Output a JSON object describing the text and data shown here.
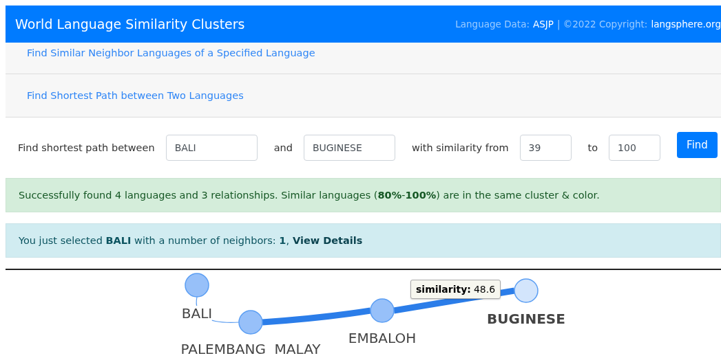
{
  "header": {
    "title": "World Language Similarity Clusters",
    "credits": [
      {
        "kind": "label",
        "text": "Language Data:"
      },
      {
        "kind": "link",
        "text": "ASJP"
      },
      {
        "kind": "label",
        "text": "| ©2022 Copyright:"
      },
      {
        "kind": "link",
        "text": "langsphere.org"
      }
    ]
  },
  "sections": [
    {
      "label": "Find Similar Neighbor Languages of a Specified Language"
    },
    {
      "label": "Find Shortest Path between Two Languages"
    }
  ],
  "form": {
    "items": [
      {
        "kind": "text",
        "text": "Find shortest path between"
      },
      {
        "kind": "input",
        "value": "BALI"
      },
      {
        "kind": "text",
        "text": "and"
      },
      {
        "kind": "input",
        "value": "BUGINESE"
      },
      {
        "kind": "text",
        "text": "with similarity from"
      },
      {
        "kind": "num",
        "value": "39"
      },
      {
        "kind": "text",
        "text": "to"
      },
      {
        "kind": "num",
        "value": "100"
      }
    ],
    "button": "Find"
  },
  "success": {
    "text": "Successfully found 4 languages and 3 relationships. Similar languages (**80%**-**100%**) are in the same cluster & color."
  },
  "info": {
    "text": "You just selected **BALI** with a number of neighbors: **1**,",
    "link": "View Details"
  },
  "graph": {
    "nodes": [
      {
        "label": "BALI",
        "selected": false
      },
      {
        "label": "PALEMBANG  MALAY",
        "selected": false
      },
      {
        "label": "EMBALOH",
        "selected": false
      },
      {
        "label": "BUGINESE",
        "selected": true
      }
    ],
    "edges": [
      {
        "strong": false
      },
      {
        "strong": true
      },
      {
        "strong": true
      }
    ],
    "tooltip": {
      "label": "similarity:",
      "value": "48.6"
    }
  }
}
